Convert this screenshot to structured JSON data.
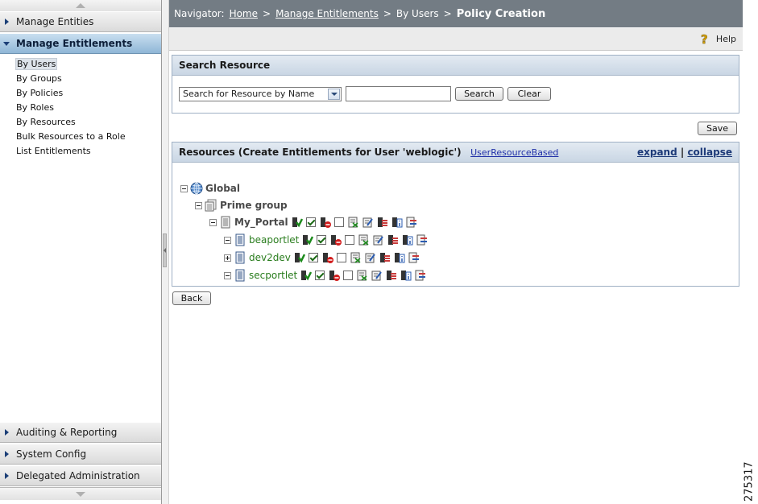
{
  "sidebar": {
    "sections_top": [
      {
        "label": "Manage Entities",
        "active": false
      },
      {
        "label": "Manage Entitlements",
        "active": true
      }
    ],
    "items": [
      {
        "label": "By Users",
        "selected": true
      },
      {
        "label": "By Groups"
      },
      {
        "label": "By Policies"
      },
      {
        "label": "By Roles"
      },
      {
        "label": "By Resources"
      },
      {
        "label": "Bulk Resources to a Role"
      },
      {
        "label": "List Entitlements"
      }
    ],
    "sections_bottom": [
      {
        "label": "Auditing & Reporting"
      },
      {
        "label": "System Config"
      },
      {
        "label": "Delegated Administration"
      }
    ]
  },
  "navigator": {
    "prefix": "Navigator:",
    "crumbs": [
      "Home",
      "Manage Entitlements",
      "By Users"
    ],
    "separator": ">",
    "current": "Policy Creation"
  },
  "help": {
    "label": "Help"
  },
  "search": {
    "title": "Search Resource",
    "select_value": "Search for Resource by Name",
    "input_value": "",
    "search_label": "Search",
    "clear_label": "Clear"
  },
  "save_label": "Save",
  "resources": {
    "title": "Resources (Create Entitlements for User 'weblogic')",
    "type_link": "UserResourceBased",
    "expand_label": "expand",
    "divider": "|",
    "collapse_label": "collapse",
    "tree": {
      "global": "Global",
      "group": "Prime group",
      "portal": "My_Portal",
      "children": [
        "beaportlet",
        "dev2dev",
        "secportlet"
      ]
    }
  },
  "back_label": "Back",
  "figure_number": "275317",
  "colors": {
    "nav_bg": "#737c84",
    "panel_header": "#c9d6e4",
    "active_section": "#8fb6d6",
    "resource_green": "#2a7d1e"
  }
}
